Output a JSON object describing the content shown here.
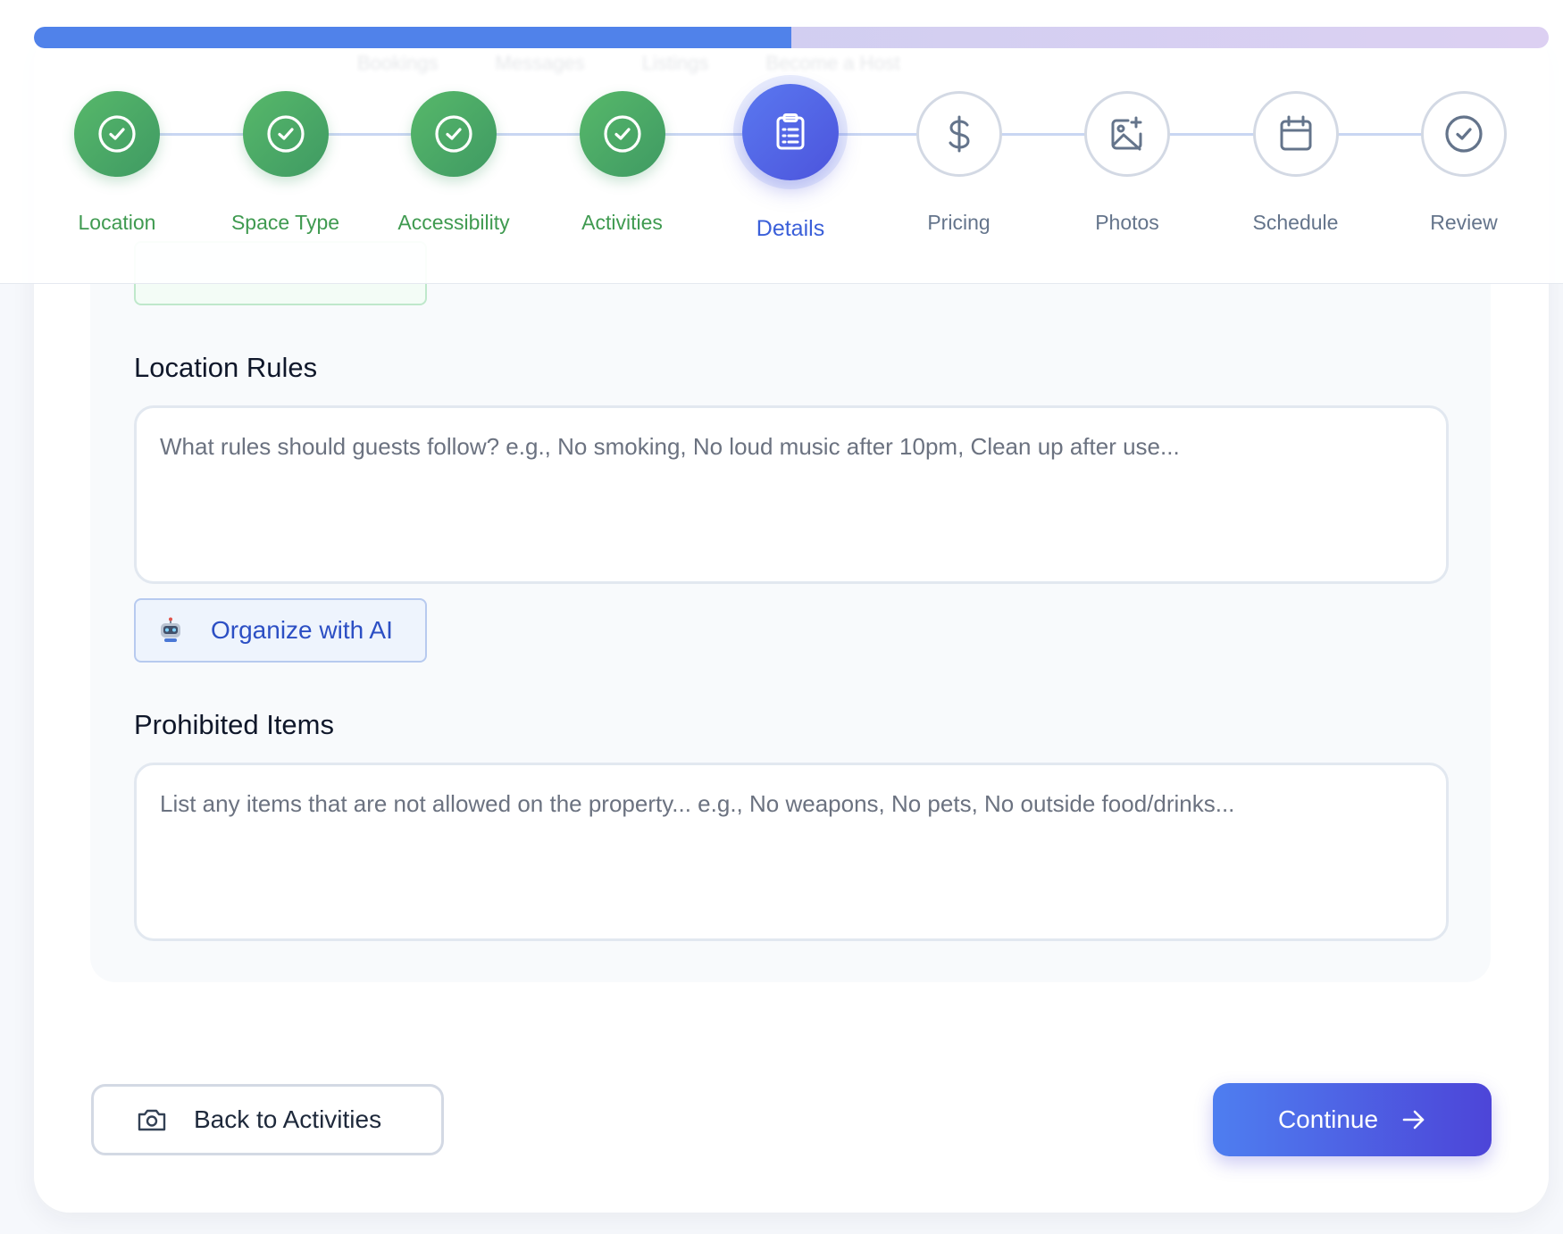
{
  "progress": {
    "fraction": 0.5
  },
  "ghost_nav": [
    "Bookings",
    "Messages",
    "Listings",
    "Become a Host"
  ],
  "steps": [
    {
      "label": "Location",
      "state": "done",
      "icon": "check-circle-icon"
    },
    {
      "label": "Space Type",
      "state": "done",
      "icon": "check-circle-icon"
    },
    {
      "label": "Accessibility",
      "state": "done",
      "icon": "check-circle-icon"
    },
    {
      "label": "Activities",
      "state": "done",
      "icon": "check-circle-icon"
    },
    {
      "label": "Details",
      "state": "active",
      "icon": "clipboard-icon"
    },
    {
      "label": "Pricing",
      "state": "todo",
      "icon": "dollar-icon"
    },
    {
      "label": "Photos",
      "state": "todo",
      "icon": "image-plus-icon"
    },
    {
      "label": "Schedule",
      "state": "todo",
      "icon": "calendar-icon"
    },
    {
      "label": "Review",
      "state": "todo",
      "icon": "check-circle-icon"
    }
  ],
  "location_rules": {
    "title": "Location Rules",
    "placeholder": "What rules should guests follow? e.g., No smoking, No loud music after 10pm, Clean up after use...",
    "value": ""
  },
  "ai_button": {
    "label": "Organize with AI",
    "icon": "robot-icon"
  },
  "prohibited_items": {
    "title": "Prohibited Items",
    "placeholder": "List any items that are not allowed on the property... e.g., No weapons, No pets, No outside food/drinks...",
    "value": ""
  },
  "footer": {
    "back_label": "Back to Activities",
    "back_icon": "camera-icon",
    "continue_label": "Continue",
    "continue_icon": "arrow-right-icon"
  },
  "colors": {
    "done": "#3f9a63",
    "active": "#4c54dc",
    "todo_border": "#d3d9e4",
    "accent": "#5082ea"
  }
}
